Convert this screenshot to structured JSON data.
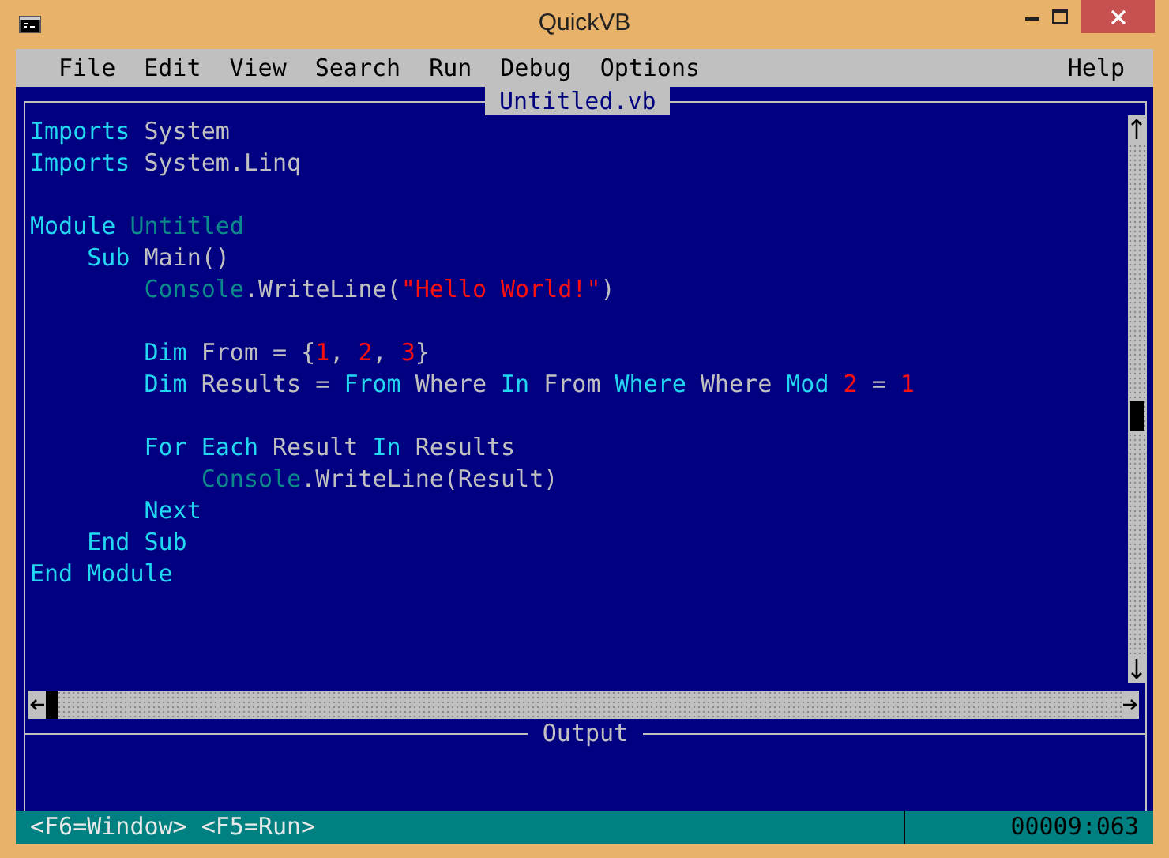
{
  "window": {
    "title": "QuickVB"
  },
  "menu": {
    "items": [
      "File",
      "Edit",
      "View",
      "Search",
      "Run",
      "Debug",
      "Options"
    ],
    "right_items": [
      "Help"
    ]
  },
  "editor": {
    "tab": "Untitled.vb",
    "lines": [
      {
        "kind": "code",
        "tokens": [
          {
            "text": "Imports",
            "kind": "keyword"
          },
          {
            "text": " System",
            "kind": "plain"
          }
        ]
      },
      {
        "kind": "code",
        "tokens": [
          {
            "text": "Imports",
            "kind": "keyword"
          },
          {
            "text": " System.Linq",
            "kind": "plain"
          }
        ]
      },
      {
        "kind": "blank"
      },
      {
        "kind": "code",
        "tokens": [
          {
            "text": "Module",
            "kind": "keyword"
          },
          {
            "text": " Untitled",
            "kind": "type"
          }
        ]
      },
      {
        "kind": "code",
        "tokens": [
          {
            "text": "    Sub",
            "kind": "keyword"
          },
          {
            "text": " Main()",
            "kind": "plain"
          }
        ]
      },
      {
        "kind": "code",
        "tokens": [
          {
            "text": "        Console",
            "kind": "type"
          },
          {
            "text": ".WriteLine(",
            "kind": "plain"
          },
          {
            "text": "\"Hello World!\"",
            "kind": "literal"
          },
          {
            "text": ")",
            "kind": "plain"
          }
        ]
      },
      {
        "kind": "blank"
      },
      {
        "kind": "code",
        "tokens": [
          {
            "text": "        Dim",
            "kind": "keyword"
          },
          {
            "text": " From = {",
            "kind": "plain"
          },
          {
            "text": "1",
            "kind": "literal"
          },
          {
            "text": ", ",
            "kind": "plain"
          },
          {
            "text": "2",
            "kind": "literal"
          },
          {
            "text": ", ",
            "kind": "plain"
          },
          {
            "text": "3",
            "kind": "literal"
          },
          {
            "text": "}",
            "kind": "plain"
          }
        ]
      },
      {
        "kind": "code",
        "tokens": [
          {
            "text": "        Dim",
            "kind": "keyword"
          },
          {
            "text": " Results = ",
            "kind": "plain"
          },
          {
            "text": "From",
            "kind": "keyword"
          },
          {
            "text": " Where ",
            "kind": "plain"
          },
          {
            "text": "In",
            "kind": "keyword"
          },
          {
            "text": " From ",
            "kind": "plain"
          },
          {
            "text": "Where",
            "kind": "keyword"
          },
          {
            "text": " Where ",
            "kind": "plain"
          },
          {
            "text": "Mod",
            "kind": "keyword"
          },
          {
            "text": " 2",
            "kind": "literal"
          },
          {
            "text": " = ",
            "kind": "plain"
          },
          {
            "text": "1",
            "kind": "literal"
          }
        ]
      },
      {
        "kind": "blank"
      },
      {
        "kind": "code",
        "tokens": [
          {
            "text": "        For Each",
            "kind": "keyword"
          },
          {
            "text": " Result ",
            "kind": "plain"
          },
          {
            "text": "In",
            "kind": "keyword"
          },
          {
            "text": " Results",
            "kind": "plain"
          }
        ]
      },
      {
        "kind": "code",
        "tokens": [
          {
            "text": "            Console",
            "kind": "type"
          },
          {
            "text": ".WriteLine(Result)",
            "kind": "plain"
          }
        ]
      },
      {
        "kind": "code",
        "tokens": [
          {
            "text": "        Next",
            "kind": "keyword"
          }
        ]
      },
      {
        "kind": "code",
        "tokens": [
          {
            "text": "    End Sub",
            "kind": "keyword"
          }
        ]
      },
      {
        "kind": "code",
        "tokens": [
          {
            "text": "End Module",
            "kind": "keyword"
          }
        ]
      }
    ]
  },
  "output": {
    "title": "Output"
  },
  "status_bar": {
    "hint": "<F6=Window> <F5=Run>",
    "position": "00009:063"
  }
}
